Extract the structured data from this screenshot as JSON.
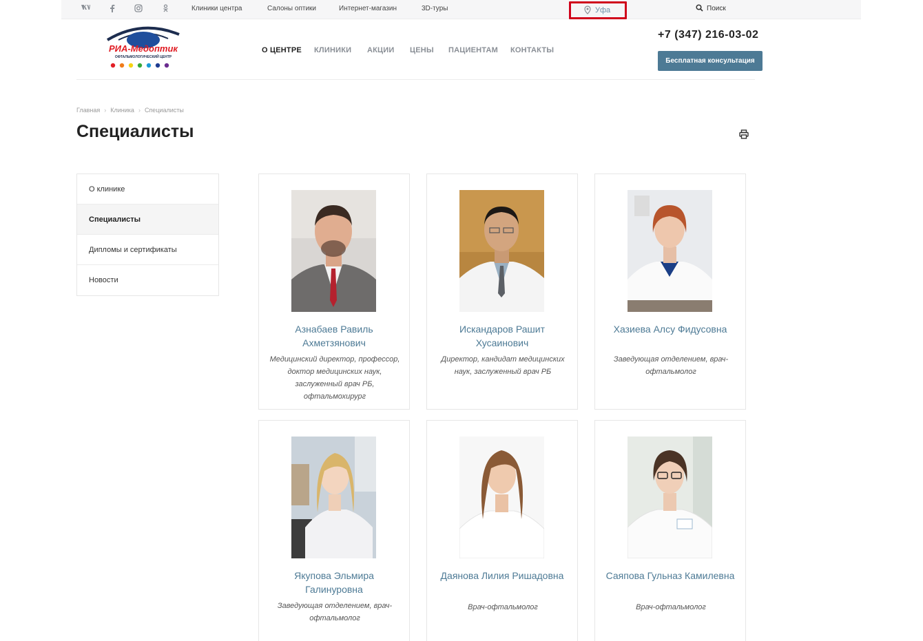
{
  "topbar": {
    "social": [
      {
        "name": "vk-icon",
        "glyph": "vk"
      },
      {
        "name": "facebook-icon",
        "glyph": "f"
      },
      {
        "name": "instagram-icon",
        "glyph": "ig"
      },
      {
        "name": "odnoklassniki-icon",
        "glyph": "ok"
      }
    ],
    "links": [
      "Клиники центра",
      "Салоны оптики",
      "Интернет-магазин",
      "3D-туры"
    ],
    "city": "Уфа",
    "search_label": "Поиск"
  },
  "header": {
    "logo_text": "РИА-Медоптик",
    "logo_subtitle": "ОФТАЛЬМОЛОГИЧЕСКИЙ ЦЕНТР",
    "nav": [
      "О ЦЕНТРЕ",
      "КЛИНИКИ",
      "АКЦИИ",
      "ЦЕНЫ",
      "ПАЦИЕНТАМ",
      "КОНТАКТЫ"
    ],
    "active_nav": "О ЦЕНТРЕ",
    "phone": "+7 (347) 216-03-02",
    "consult_button": "Бесплатная консультация"
  },
  "breadcrumbs": [
    "Главная",
    "Клиника",
    "Специалисты"
  ],
  "page_title": "Специалисты",
  "sidemenu": {
    "items": [
      "О клинике",
      "Специалисты",
      "Дипломы и сертификаты",
      "Новости"
    ],
    "active": "Специалисты"
  },
  "specialists": [
    {
      "name": "Азнабаев Равиль Ахметзянович",
      "role": "Медицинский директор, профессор, доктор медицинских наук, заслуженный врач РБ, офтальмохирург"
    },
    {
      "name": "Искандаров Рашит Хусаинович",
      "role": "Директор, кандидат медицинских наук, заслуженный врач РБ"
    },
    {
      "name": "Хазиева Алсу Фидусовна",
      "role": "Заведующая отделением, врач-офтальмолог"
    },
    {
      "name": "Якупова Эльмира Галинуровна",
      "role": "Заведующая отделением, врач-офтальмолог"
    },
    {
      "name": "Даянова Лилия Ришадовна",
      "role": "Врач-офтальмолог"
    },
    {
      "name": "Саяпова Гульназ Камилевна",
      "role": "Врач-офтальмолог"
    }
  ],
  "colors": {
    "accent": "#4d7a95",
    "highlight_box": "#d0021b",
    "topbar_bg": "#f6f6f7"
  }
}
